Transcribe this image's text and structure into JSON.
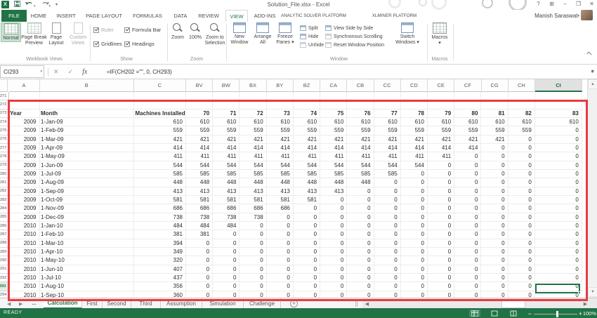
{
  "titlebar": {
    "title": "Solution_File.xlsx - Excel",
    "qat_icons": [
      "excel-logo",
      "save",
      "undo",
      "redo",
      "customize"
    ],
    "window_icons": [
      "help",
      "ribbon-options",
      "minimize",
      "restore",
      "close"
    ]
  },
  "account": {
    "name": "Manish Saraswat"
  },
  "ribbon_tabs": [
    {
      "label": "FILE",
      "file": true
    },
    {
      "label": "HOME"
    },
    {
      "label": "INSERT"
    },
    {
      "label": "PAGE LAYOUT"
    },
    {
      "label": "FORMULAS"
    },
    {
      "label": "DATA"
    },
    {
      "label": "REVIEW"
    },
    {
      "label": "VIEW",
      "active": true
    },
    {
      "label": "ADD-INS"
    },
    {
      "label": "ANALYTIC SOLVER PLATFORM"
    },
    {
      "label": "XLMINER PLATFORM"
    }
  ],
  "ribbon": {
    "workbook_views": {
      "label": "Workbook Views",
      "normal": "Normal",
      "pbp": "Page Break Preview",
      "pl": "Page Layout",
      "cv": "Custom Views"
    },
    "show": {
      "label": "Show",
      "ruler": "Ruler",
      "formula_bar": "Formula Bar",
      "gridlines": "Gridlines",
      "headings": "Headings"
    },
    "zoom": {
      "label": "Zoom",
      "zoom": "Zoom",
      "pct": "100%",
      "zts1": "Zoom to",
      "zts2": "Selection"
    },
    "window": {
      "label": "Window",
      "nw1": "New",
      "nw2": "Window",
      "aa1": "Arrange",
      "aa2": "All",
      "fp1": "Freeze",
      "fp2": "Panes",
      "split": "Split",
      "hide": "Hide",
      "unhide": "Unhide",
      "vsbs": "View Side by Side",
      "ss": "Synchronous Scrolling",
      "rwp": "Reset Window Position",
      "sw1": "Switch",
      "sw2": "Windows"
    },
    "macros": {
      "label": "Macros",
      "button": "Macros"
    }
  },
  "formula_bar": {
    "name_box": "CI293",
    "formula": "=IF(CH202 =\"\", 0, CH293)"
  },
  "sheet": {
    "col_headers": [
      "A",
      "B",
      "C",
      "BV",
      "BW",
      "BX",
      "BY",
      "BZ",
      "CA",
      "CB",
      "CC",
      "CD",
      "CE",
      "CF",
      "CG",
      "CH",
      "CI"
    ],
    "selected_col": "CI",
    "selected_row": 293,
    "first_row_num": 271,
    "header_row": {
      "row": 273,
      "year": "Year",
      "month": "Month",
      "installed": "Machines Installed",
      "numbers": [
        70,
        71,
        72,
        73,
        74,
        75,
        76,
        77,
        78,
        79,
        80,
        81,
        82,
        83
      ]
    },
    "rows": [
      {
        "row": 274,
        "year": 2009,
        "month": "1-Jan-09",
        "installed": 610,
        "cells": [
          610,
          610,
          610,
          610,
          610,
          610,
          610,
          610,
          610,
          610,
          610,
          610,
          610,
          610
        ]
      },
      {
        "row": 275,
        "year": 2009,
        "month": "1-Feb-09",
        "installed": 559,
        "cells": [
          559,
          559,
          559,
          559,
          559,
          559,
          559,
          559,
          559,
          559,
          559,
          559,
          559,
          0
        ]
      },
      {
        "row": 276,
        "year": 2009,
        "month": "1-Mar-09",
        "installed": 421,
        "cells": [
          421,
          421,
          421,
          421,
          421,
          421,
          421,
          421,
          421,
          421,
          421,
          421,
          0,
          0
        ]
      },
      {
        "row": 277,
        "year": 2009,
        "month": "1-Apr-09",
        "installed": 414,
        "cells": [
          414,
          414,
          414,
          414,
          414,
          414,
          414,
          414,
          414,
          414,
          414,
          0,
          0,
          0
        ]
      },
      {
        "row": 278,
        "year": 2009,
        "month": "1-May-09",
        "installed": 411,
        "cells": [
          411,
          411,
          411,
          411,
          411,
          411,
          411,
          411,
          411,
          411,
          0,
          0,
          0,
          0
        ]
      },
      {
        "row": 279,
        "year": 2009,
        "month": "1-Jun-09",
        "installed": 544,
        "cells": [
          544,
          544,
          544,
          544,
          544,
          544,
          544,
          544,
          544,
          0,
          0,
          0,
          0,
          0
        ]
      },
      {
        "row": 280,
        "year": 2009,
        "month": "1-Jul-09",
        "installed": 585,
        "cells": [
          585,
          585,
          585,
          585,
          585,
          585,
          585,
          585,
          0,
          0,
          0,
          0,
          0,
          0
        ]
      },
      {
        "row": 281,
        "year": 2009,
        "month": "1-Aug-09",
        "installed": 448,
        "cells": [
          448,
          448,
          448,
          448,
          448,
          448,
          448,
          0,
          0,
          0,
          0,
          0,
          0,
          0
        ]
      },
      {
        "row": 282,
        "year": 2009,
        "month": "1-Sep-09",
        "installed": 413,
        "cells": [
          413,
          413,
          413,
          413,
          413,
          413,
          0,
          0,
          0,
          0,
          0,
          0,
          0,
          0
        ]
      },
      {
        "row": 283,
        "year": 2009,
        "month": "1-Oct-09",
        "installed": 581,
        "cells": [
          581,
          581,
          581,
          581,
          581,
          0,
          0,
          0,
          0,
          0,
          0,
          0,
          0,
          0
        ]
      },
      {
        "row": 284,
        "year": 2009,
        "month": "1-Nov-09",
        "installed": 686,
        "cells": [
          686,
          686,
          686,
          686,
          0,
          0,
          0,
          0,
          0,
          0,
          0,
          0,
          0,
          0
        ]
      },
      {
        "row": 285,
        "year": 2009,
        "month": "1-Dec-09",
        "installed": 738,
        "cells": [
          738,
          738,
          738,
          0,
          0,
          0,
          0,
          0,
          0,
          0,
          0,
          0,
          0,
          0
        ]
      },
      {
        "row": 286,
        "year": 2010,
        "month": "1-Jan-10",
        "installed": 484,
        "cells": [
          484,
          484,
          0,
          0,
          0,
          0,
          0,
          0,
          0,
          0,
          0,
          0,
          0,
          0
        ]
      },
      {
        "row": 287,
        "year": 2010,
        "month": "1-Feb-10",
        "installed": 381,
        "cells": [
          381,
          0,
          0,
          0,
          0,
          0,
          0,
          0,
          0,
          0,
          0,
          0,
          0,
          0
        ]
      },
      {
        "row": 288,
        "year": 2010,
        "month": "1-Mar-10",
        "installed": 394,
        "cells": [
          0,
          0,
          0,
          0,
          0,
          0,
          0,
          0,
          0,
          0,
          0,
          0,
          0,
          0
        ]
      },
      {
        "row": 289,
        "year": 2010,
        "month": "1-Apr-10",
        "installed": 349,
        "cells": [
          0,
          0,
          0,
          0,
          0,
          0,
          0,
          0,
          0,
          0,
          0,
          0,
          0,
          0
        ]
      },
      {
        "row": 290,
        "year": 2010,
        "month": "1-May-10",
        "installed": 320,
        "cells": [
          0,
          0,
          0,
          0,
          0,
          0,
          0,
          0,
          0,
          0,
          0,
          0,
          0,
          0
        ]
      },
      {
        "row": 291,
        "year": 2010,
        "month": "1-Jun-10",
        "installed": 407,
        "cells": [
          0,
          0,
          0,
          0,
          0,
          0,
          0,
          0,
          0,
          0,
          0,
          0,
          0,
          0
        ]
      },
      {
        "row": 292,
        "year": 2010,
        "month": "1-Jul-10",
        "installed": 437,
        "cells": [
          0,
          0,
          0,
          0,
          0,
          0,
          0,
          0,
          0,
          0,
          0,
          0,
          0,
          0
        ]
      },
      {
        "row": 293,
        "year": 2010,
        "month": "1-Aug-10",
        "installed": 356,
        "cells": [
          0,
          0,
          0,
          0,
          0,
          0,
          0,
          0,
          0,
          0,
          0,
          0,
          0,
          0
        ]
      },
      {
        "row": 294,
        "year": 2010,
        "month": "1-Sep-10",
        "installed": 360,
        "cells": [
          0,
          0,
          0,
          0,
          0,
          0,
          0,
          0,
          0,
          0,
          0,
          0,
          0,
          0
        ]
      }
    ]
  },
  "tabbar": {
    "tabs": [
      "Calculation",
      "First",
      "Second",
      "Third",
      "Assumption",
      "Simulation",
      "Challenge"
    ],
    "active": "Calculation"
  },
  "statusbar": {
    "mode": "READY",
    "zoom": "100%",
    "view_icons": [
      "normal-view",
      "page-layout-view",
      "page-break-view"
    ]
  }
}
